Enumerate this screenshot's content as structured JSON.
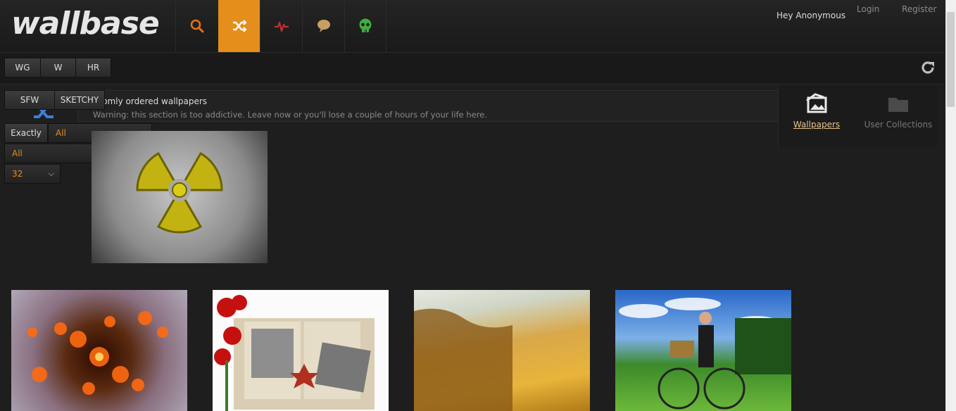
{
  "brand": {
    "logo": "wallbase"
  },
  "nav": {
    "items": [
      {
        "name": "search",
        "icon": "magnifier-icon"
      },
      {
        "name": "random",
        "icon": "shuffle-icon",
        "active": true
      },
      {
        "name": "toplist",
        "icon": "pulse-icon"
      },
      {
        "name": "forum",
        "icon": "speech-bubble-icon"
      },
      {
        "name": "nsfw",
        "icon": "skull-icon"
      }
    ]
  },
  "user": {
    "greeting": "Hey Anonymous",
    "login": "Login",
    "register": "Register"
  },
  "category_buttons": {
    "wg": "WG",
    "w": "W",
    "hr": "HR"
  },
  "purity_buttons": {
    "sfw": "SFW",
    "sketchy": "SKETCHY"
  },
  "filters": {
    "match": {
      "label": "Exactly",
      "value": "All"
    },
    "ratio": {
      "value": "All"
    },
    "per_page": {
      "value": "32"
    }
  },
  "info": {
    "title": "ndomly ordered wallpapers",
    "warning": "Warning: this section is too addictive. Leave now or you'll lose a couple of hours of your life here."
  },
  "tabs": {
    "wallpapers": "Wallpapers",
    "collections": "User Collections"
  },
  "thumbnails": [
    {
      "subject": "radiation symbol"
    },
    {
      "subject": "orange fractal"
    },
    {
      "subject": "red carnations and old photo album"
    },
    {
      "subject": "blurred sand dune"
    },
    {
      "subject": "woman on bicycle in meadow"
    }
  ],
  "colors": {
    "accent": "#e48e1c",
    "background": "#1e1e1e"
  }
}
